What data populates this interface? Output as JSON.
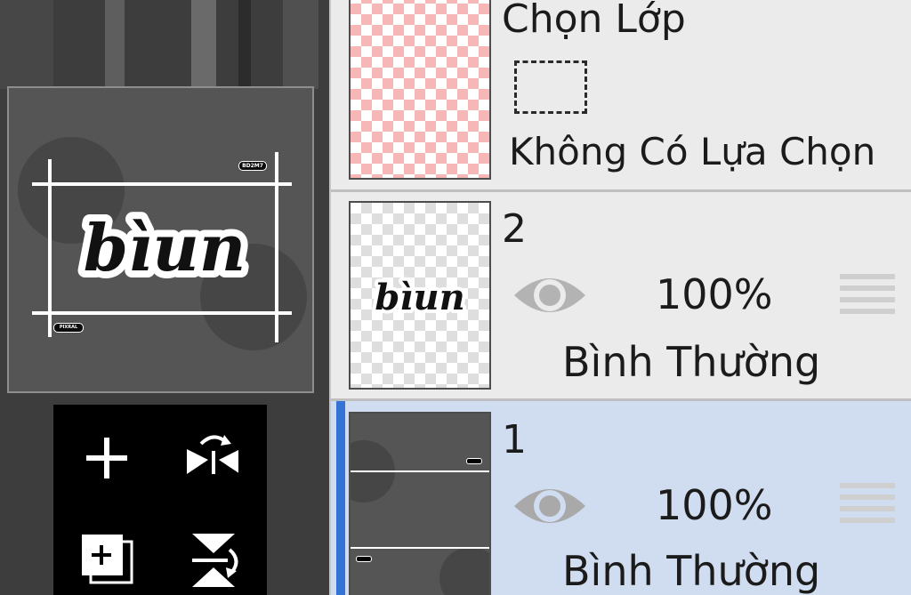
{
  "canvas": {
    "preview_text": "bìun",
    "corner_tag_top": "BD2M7",
    "corner_tag_bottom": "PIXRAL"
  },
  "tools": [
    {
      "name": "add-layer",
      "icon": "plus-icon"
    },
    {
      "name": "flip-horizontal",
      "icon": "flip-horizontal-icon"
    },
    {
      "name": "duplicate-layer",
      "icon": "duplicate-layer-icon"
    },
    {
      "name": "flip-vertical",
      "icon": "flip-vertical-icon"
    }
  ],
  "layer_panel": {
    "selection_layer": {
      "title": "Chọn Lớp",
      "status": "Không Có Lựa Chọn",
      "icon": "dashed-selection-icon"
    },
    "layers": [
      {
        "number": "2",
        "opacity": "100%",
        "blend_mode": "Bình Thường",
        "visible_icon": "eye-icon",
        "selected": false,
        "thumb_text": "bìun"
      },
      {
        "number": "1",
        "opacity": "100%",
        "blend_mode": "Bình Thường",
        "visible_icon": "eye-icon",
        "selected": true
      }
    ]
  },
  "colors": {
    "selected_row": "#d0dcf0",
    "selected_accent": "#3572d6",
    "selection_checker": "#f7b7b7",
    "tool_panel": "#000000"
  }
}
